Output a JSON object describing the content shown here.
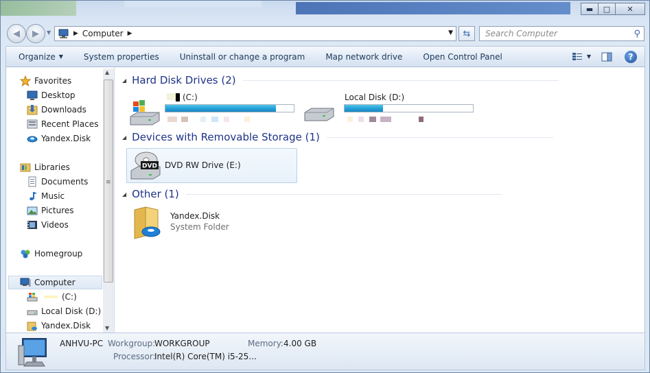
{
  "window": {
    "controls": {
      "minimize": "▬",
      "maximize": "□",
      "close": "✕"
    }
  },
  "address": {
    "crumb": "Computer"
  },
  "search": {
    "placeholder": "Search Computer"
  },
  "toolbar": {
    "organize": "Organize",
    "system_properties": "System properties",
    "uninstall": "Uninstall or change a program",
    "map_drive": "Map network drive",
    "control_panel": "Open Control Panel",
    "help": "?"
  },
  "sidebar": {
    "favorites": "Favorites",
    "desktop": "Desktop",
    "downloads": "Downloads",
    "recent_places": "Recent Places",
    "yandex_disk": "Yandex.Disk",
    "libraries": "Libraries",
    "documents": "Documents",
    "music": "Music",
    "pictures": "Pictures",
    "videos": "Videos",
    "homegroup": "Homegroup",
    "computer": "Computer",
    "drive_c": "(C:)",
    "drive_d": "Local Disk (D:)",
    "yandex_disk_2": "Yandex.Disk"
  },
  "groups": {
    "hdd": "Hard Disk Drives (2)",
    "removable": "Devices with Removable Storage (1)",
    "other": "Other (1)"
  },
  "drives": {
    "c": {
      "name": "(C:)",
      "used_fraction": 0.86
    },
    "d": {
      "name": "Local Disk (D:)",
      "used_fraction": 0.3
    },
    "e": {
      "name": "DVD RW Drive (E:)",
      "badge": "DVD"
    }
  },
  "other": {
    "name": "Yandex.Disk",
    "type": "System Folder"
  },
  "details": {
    "computer_name": "ANHVU-PC",
    "workgroup_label": "Workgroup:",
    "workgroup": "WORKGROUP",
    "memory_label": "Memory:",
    "memory": "4.00 GB",
    "processor_label": "Processor:",
    "processor": "Intel(R) Core(TM) i5-25..."
  },
  "colors": {
    "accent_heading": "#1e3287",
    "bar_fill": "#26a0da"
  }
}
